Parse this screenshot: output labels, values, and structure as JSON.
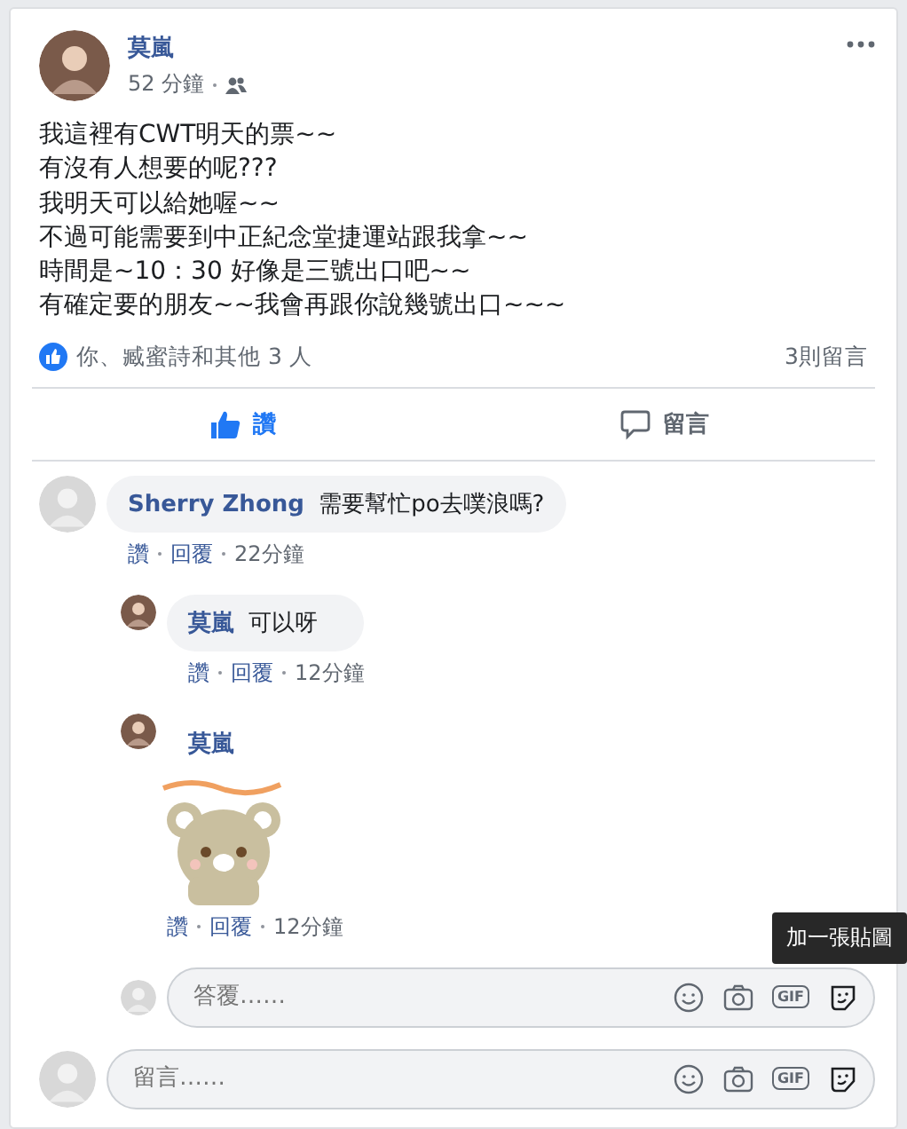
{
  "post": {
    "author": "莫嵐",
    "time": "52 分鐘",
    "lines": [
      "我這裡有CWT明天的票~~",
      "有沒有人想要的呢???",
      "我明天可以給她喔~~",
      "不過可能需要到中正紀念堂捷運站跟我拿~~",
      "時間是~10：30 好像是三號出口吧~~",
      "有確定要的朋友~~我會再跟你說幾號出口~~~"
    ],
    "reactions": "你、臧蜜詩和其他 3 人",
    "comment_count": "3則留言"
  },
  "actions": [
    {
      "kind": "like",
      "label": "讚",
      "selected": true
    },
    {
      "kind": "comment",
      "label": "留言",
      "selected": false
    }
  ],
  "comments": [
    {
      "kind": "text",
      "author": "Sherry Zhong",
      "text": "需要幫忙po去噗浪嗎?",
      "links": [
        "讚",
        "回覆"
      ],
      "time": "22分鐘",
      "children": [
        {
          "kind": "text",
          "author": "莫嵐",
          "text": "可以呀",
          "links": [
            "讚",
            "回覆"
          ],
          "time": "12分鐘"
        },
        {
          "kind": "sticker",
          "author": "莫嵐",
          "links": [
            "讚",
            "回覆"
          ],
          "time": "12分鐘"
        }
      ]
    }
  ],
  "reply_field": {
    "placeholder": "答覆……",
    "gif": "GIF",
    "tooltip": "加一張貼圖"
  },
  "comment_field": {
    "placeholder": "留言……",
    "gif": "GIF"
  }
}
